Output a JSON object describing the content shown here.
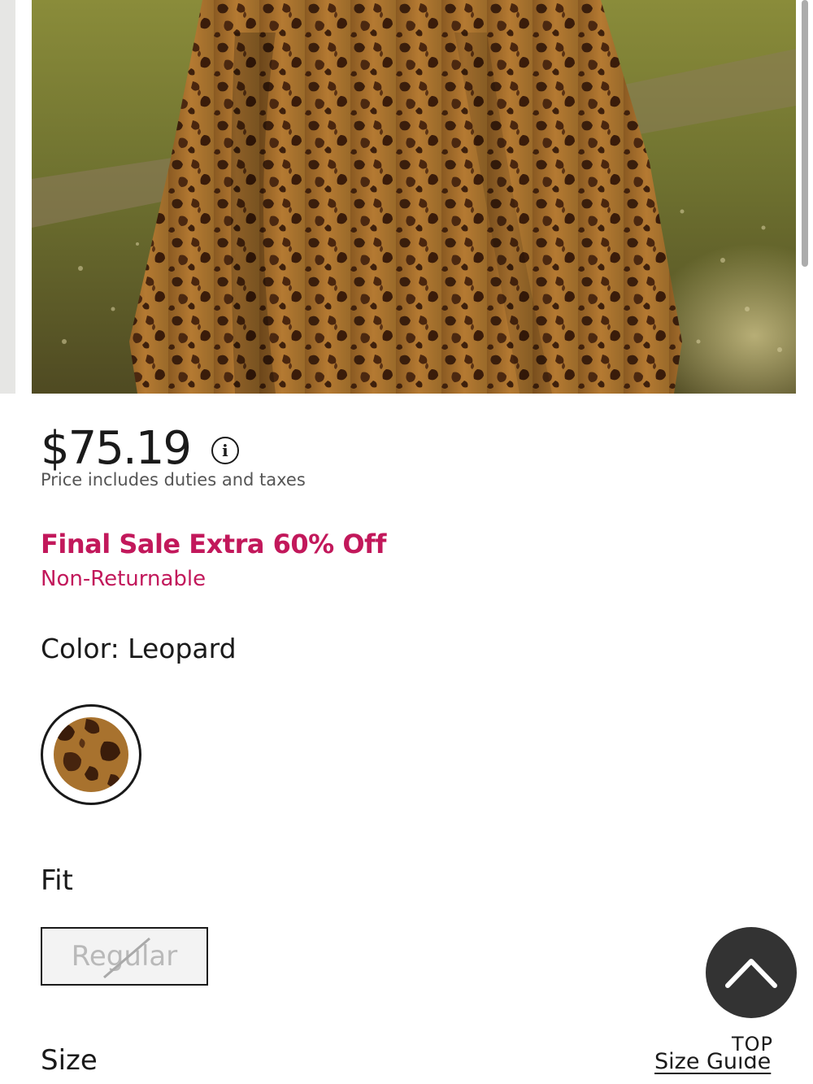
{
  "product": {
    "image_alt": "Leopard print skirt in a grassy field",
    "price": "$75.19",
    "price_note": "Price includes duties and taxes",
    "info_icon": "info-icon"
  },
  "sale": {
    "title": "Final Sale Extra 60% Off",
    "subtitle": "Non-Returnable",
    "color": "#c2185b"
  },
  "color": {
    "label": "Color: Leopard",
    "swatches": [
      {
        "name": "Leopard",
        "selected": true
      }
    ]
  },
  "fit": {
    "label": "Fit",
    "options": [
      {
        "label": "Regular",
        "available": false
      }
    ]
  },
  "size": {
    "label": "Size",
    "guide_link": "Size Guide"
  },
  "back_to_top": {
    "label": "TOP",
    "icon": "chevron-up-icon"
  }
}
